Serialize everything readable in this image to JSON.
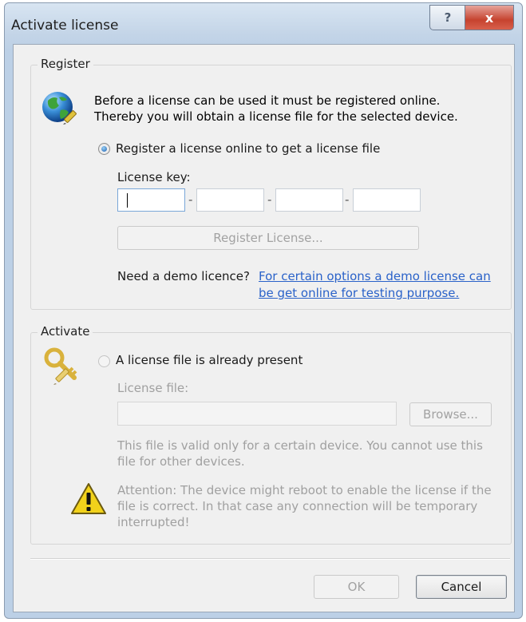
{
  "window": {
    "title": "Activate license",
    "help_glyph": "?",
    "close_glyph": "x"
  },
  "register": {
    "legend": "Register",
    "icon": "globe-icon",
    "description": "Before a license can be used it must be registered online. Thereby you will obtain a license file for the selected device.",
    "radio_label": "Register a license online to get a license file",
    "radio_selected": true,
    "license_key_label": "License key:",
    "license_key_parts": [
      "",
      "",
      "",
      ""
    ],
    "separator": "-",
    "register_button": "Register License...",
    "demo_prompt": "Need a demo licence?",
    "demo_link": "For certain options a demo license can be get online for testing purpose."
  },
  "activate": {
    "legend": "Activate",
    "icon": "key-icon",
    "radio_label": "A license file is already present",
    "radio_selected": false,
    "license_file_label": "License file:",
    "license_file_value": "",
    "browse_button": "Browse...",
    "validity_note": "This file is valid only for a certain device. You cannot use this file for other devices.",
    "warning_icon": "warning-icon",
    "warning_text": "Attention: The device might reboot to enable the license if the file is correct. In that case any connection will be temporary interrupted!"
  },
  "footer": {
    "ok_button": "OK",
    "cancel_button": "Cancel"
  },
  "colors": {
    "link": "#2a62c9",
    "close": "#c6432f",
    "warning": "#f2d21b"
  }
}
